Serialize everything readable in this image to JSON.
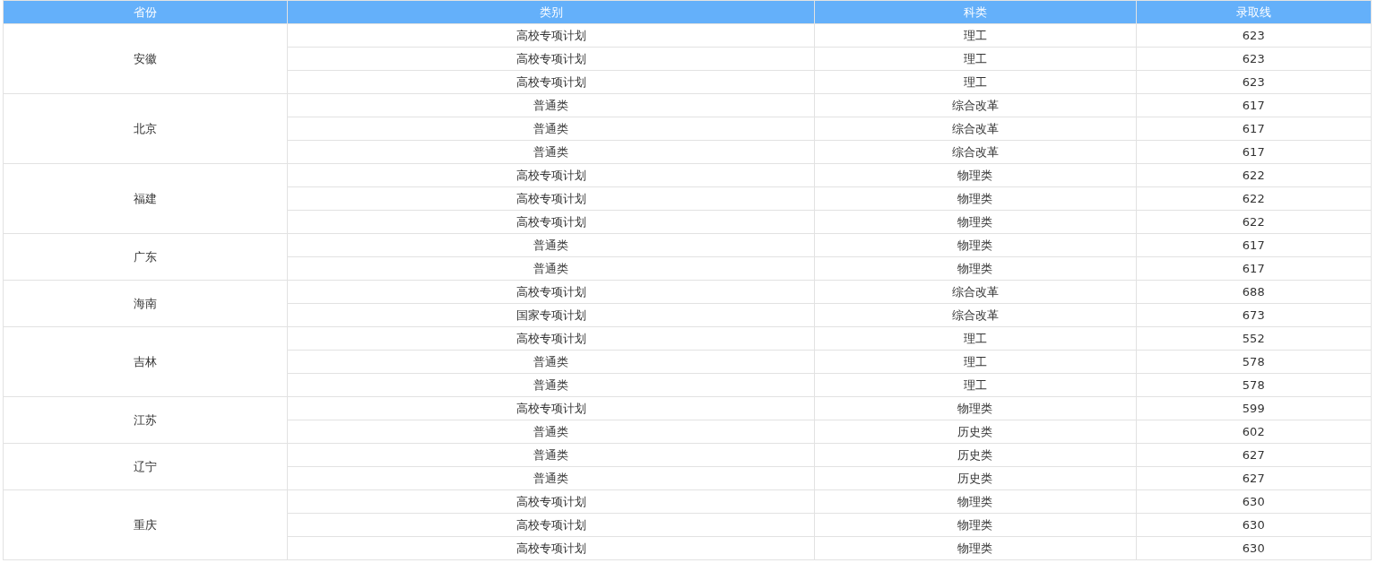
{
  "table": {
    "columns": [
      "省份",
      "类别",
      "科类",
      "录取线"
    ],
    "groups": [
      {
        "province": "安徽",
        "rows": [
          [
            "高校专项计划",
            "理工",
            "623"
          ],
          [
            "高校专项计划",
            "理工",
            "623"
          ],
          [
            "高校专项计划",
            "理工",
            "623"
          ]
        ]
      },
      {
        "province": "北京",
        "rows": [
          [
            "普通类",
            "综合改革",
            "617"
          ],
          [
            "普通类",
            "综合改革",
            "617"
          ],
          [
            "普通类",
            "综合改革",
            "617"
          ]
        ]
      },
      {
        "province": "福建",
        "rows": [
          [
            "高校专项计划",
            "物理类",
            "622"
          ],
          [
            "高校专项计划",
            "物理类",
            "622"
          ],
          [
            "高校专项计划",
            "物理类",
            "622"
          ]
        ]
      },
      {
        "province": "广东",
        "rows": [
          [
            "普通类",
            "物理类",
            "617"
          ],
          [
            "普通类",
            "物理类",
            "617"
          ]
        ]
      },
      {
        "province": "海南",
        "rows": [
          [
            "高校专项计划",
            "综合改革",
            "688"
          ],
          [
            "国家专项计划",
            "综合改革",
            "673"
          ]
        ]
      },
      {
        "province": "吉林",
        "rows": [
          [
            "高校专项计划",
            "理工",
            "552"
          ],
          [
            "普通类",
            "理工",
            "578"
          ],
          [
            "普通类",
            "理工",
            "578"
          ]
        ]
      },
      {
        "province": "江苏",
        "rows": [
          [
            "高校专项计划",
            "物理类",
            "599"
          ],
          [
            "普通类",
            "历史类",
            "602"
          ]
        ]
      },
      {
        "province": "辽宁",
        "rows": [
          [
            "普通类",
            "历史类",
            "627"
          ],
          [
            "普通类",
            "历史类",
            "627"
          ]
        ]
      },
      {
        "province": "重庆",
        "rows": [
          [
            "高校专项计划",
            "物理类",
            "630"
          ],
          [
            "高校专项计划",
            "物理类",
            "630"
          ],
          [
            "高校专项计划",
            "物理类",
            "630"
          ]
        ]
      }
    ]
  }
}
